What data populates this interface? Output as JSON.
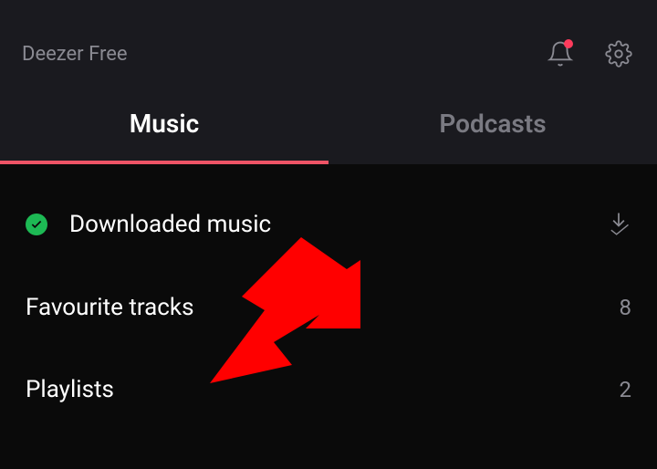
{
  "header": {
    "app_title": "Deezer Free"
  },
  "tabs": {
    "music": "Music",
    "podcasts": "Podcasts"
  },
  "items": {
    "downloaded": {
      "label": "Downloaded music"
    },
    "favourites": {
      "label": "Favourite tracks",
      "count": "8"
    },
    "playlists": {
      "label": "Playlists",
      "count": "2"
    }
  }
}
